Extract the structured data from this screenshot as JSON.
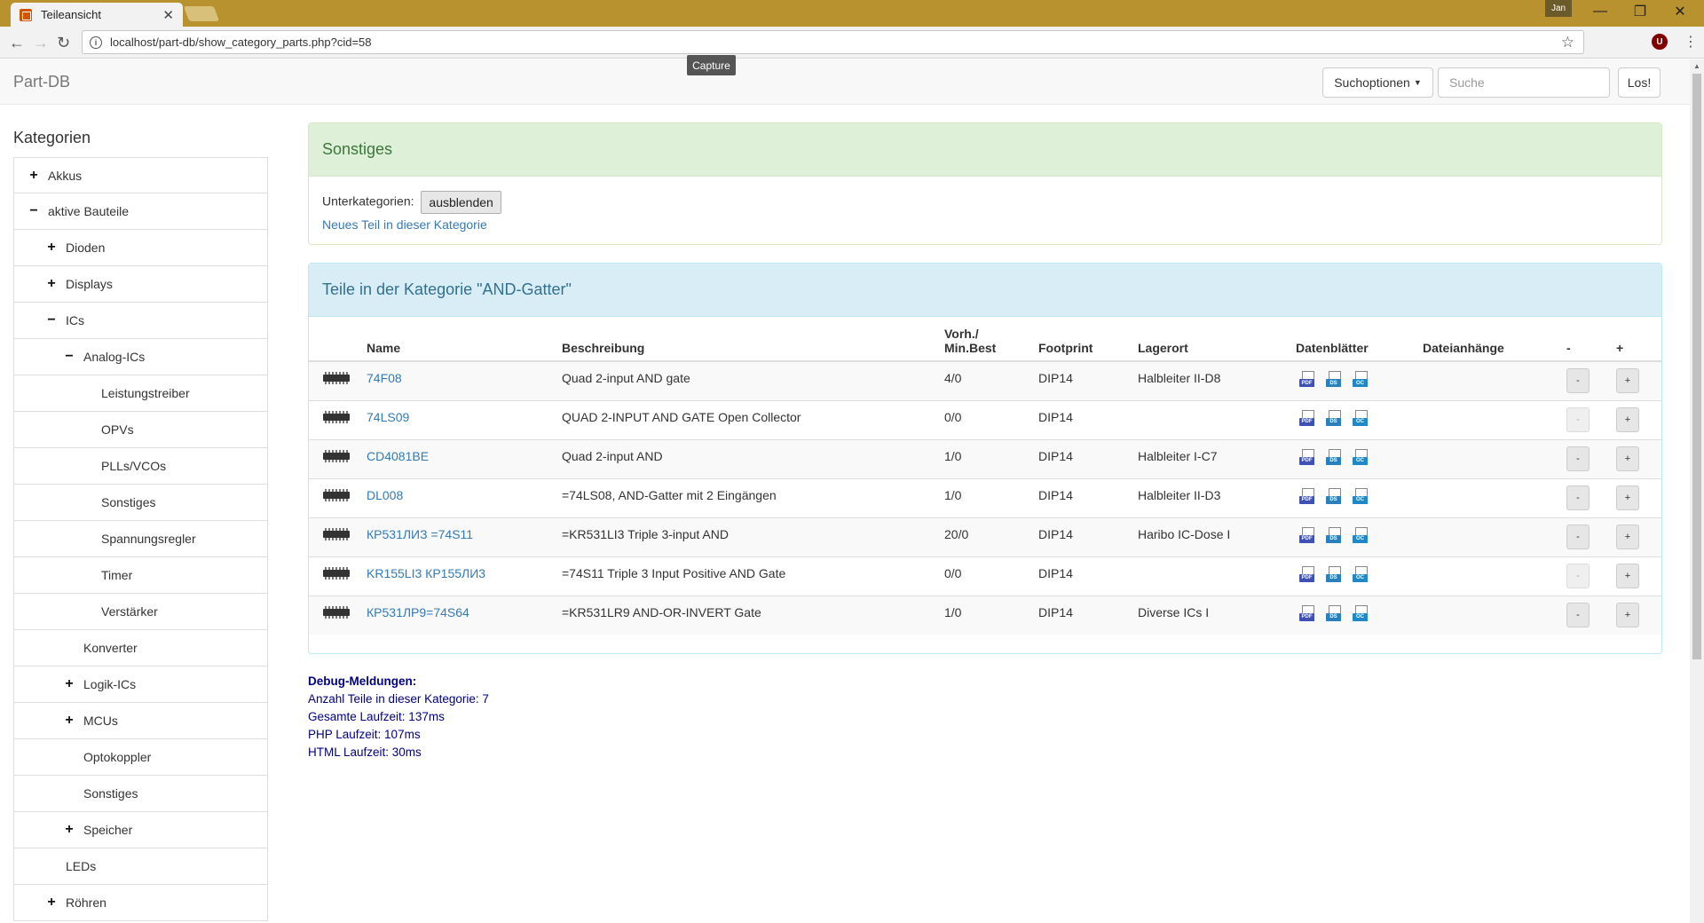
{
  "browser": {
    "tab_title": "Teileansicht",
    "url": "localhost/part-db/show_category_parts.php?cid=58",
    "user": "Jan",
    "tooltip": "Capture"
  },
  "navbar": {
    "brand": "Part-DB",
    "search_options_label": "Suchoptionen",
    "search_placeholder": "Suche",
    "go_label": "Los!"
  },
  "sidebar": {
    "title": "Kategorien",
    "items": [
      {
        "label": "Akkus",
        "sign": "+"
      },
      {
        "label": "aktive Bauteile",
        "sign": "−"
      },
      {
        "label": "Dioden",
        "sign": "+"
      },
      {
        "label": "Displays",
        "sign": "+"
      },
      {
        "label": "ICs",
        "sign": "−"
      },
      {
        "label": "Analog-ICs",
        "sign": "−"
      },
      {
        "label": "Leistungstreiber",
        "sign": ""
      },
      {
        "label": "OPVs",
        "sign": ""
      },
      {
        "label": "PLLs/VCOs",
        "sign": ""
      },
      {
        "label": "Sonstiges",
        "sign": ""
      },
      {
        "label": "Spannungsregler",
        "sign": ""
      },
      {
        "label": "Timer",
        "sign": ""
      },
      {
        "label": "Verstärker",
        "sign": ""
      },
      {
        "label": "Konverter",
        "sign": ""
      },
      {
        "label": "Logik-ICs",
        "sign": "+"
      },
      {
        "label": "MCUs",
        "sign": "+"
      },
      {
        "label": "Optokoppler",
        "sign": ""
      },
      {
        "label": "Sonstiges",
        "sign": ""
      },
      {
        "label": "Speicher",
        "sign": "+"
      },
      {
        "label": "LEDs",
        "sign": ""
      },
      {
        "label": "Röhren",
        "sign": "+"
      }
    ]
  },
  "category_panel": {
    "title": "Sonstiges",
    "subcategories_label": "Unterkategorien:",
    "hide_button": "ausblenden",
    "new_part_link": "Neues Teil in dieser Kategorie"
  },
  "parts_panel": {
    "title": "Teile in der Kategorie \"AND-Gatter\"",
    "columns": {
      "name": "Name",
      "description": "Beschreibung",
      "stock_line1": "Vorh./",
      "stock_line2": "Min.Best",
      "footprint": "Footprint",
      "location": "Lagerort",
      "datasheets": "Datenblätter",
      "attachments": "Dateianhänge",
      "minus": "-",
      "plus": "+"
    },
    "rows": [
      {
        "name": "74F08",
        "description": "Quad 2-input AND gate",
        "stock": "4/0",
        "footprint": "DIP14",
        "location": "Halbleiter II-D8",
        "minus_enabled": true
      },
      {
        "name": "74LS09",
        "description": "QUAD 2-INPUT AND GATE Open Collector",
        "stock": "0/0",
        "footprint": "DIP14",
        "location": "",
        "minus_enabled": false
      },
      {
        "name": "CD4081BE",
        "description": "Quad 2-input AND",
        "stock": "1/0",
        "footprint": "DIP14",
        "location": "Halbleiter I-C7",
        "minus_enabled": true
      },
      {
        "name": "DL008",
        "description": "=74LS08, AND-Gatter mit 2 Eingängen",
        "stock": "1/0",
        "footprint": "DIP14",
        "location": "Halbleiter II-D3",
        "minus_enabled": true
      },
      {
        "name": "КР531ЛИЗ =74S11",
        "description": "=KR531LI3 Triple 3-input AND",
        "stock": "20/0",
        "footprint": "DIP14",
        "location": "Haribo IC-Dose I",
        "minus_enabled": true
      },
      {
        "name": "KR155LI3 КР155ЛИ3",
        "description": "=74S11 Triple 3 Input Positive AND Gate",
        "stock": "0/0",
        "footprint": "DIP14",
        "location": "",
        "minus_enabled": false
      },
      {
        "name": "КР531ЛР9=74S64",
        "description": "=KR531LR9 AND-OR-INVERT Gate",
        "stock": "1/0",
        "footprint": "DIP14",
        "location": "Diverse ICs I",
        "minus_enabled": true
      }
    ],
    "datasheet_icons": [
      "alldatasheet-icon",
      "datasheetcatalog-icon",
      "octopart-icon"
    ],
    "button_minus": "-",
    "button_plus": "+"
  },
  "debug": {
    "title": "Debug-Meldungen:",
    "lines": [
      "Anzahl Teile in dieser Kategorie: 7",
      "Gesamte Laufzeit: 137ms",
      "PHP Laufzeit: 107ms",
      "HTML Laufzeit: 30ms"
    ]
  }
}
